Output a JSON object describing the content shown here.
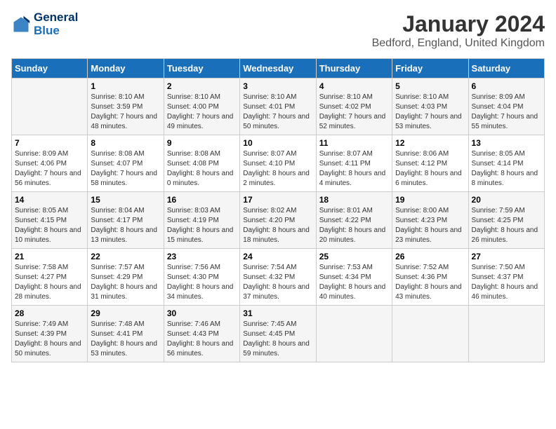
{
  "header": {
    "logo_line1": "General",
    "logo_line2": "Blue",
    "month_title": "January 2024",
    "location": "Bedford, England, United Kingdom"
  },
  "days_of_week": [
    "Sunday",
    "Monday",
    "Tuesday",
    "Wednesday",
    "Thursday",
    "Friday",
    "Saturday"
  ],
  "weeks": [
    [
      {
        "day": "",
        "sunrise": "",
        "sunset": "",
        "daylight": ""
      },
      {
        "day": "1",
        "sunrise": "Sunrise: 8:10 AM",
        "sunset": "Sunset: 3:59 PM",
        "daylight": "Daylight: 7 hours and 48 minutes."
      },
      {
        "day": "2",
        "sunrise": "Sunrise: 8:10 AM",
        "sunset": "Sunset: 4:00 PM",
        "daylight": "Daylight: 7 hours and 49 minutes."
      },
      {
        "day": "3",
        "sunrise": "Sunrise: 8:10 AM",
        "sunset": "Sunset: 4:01 PM",
        "daylight": "Daylight: 7 hours and 50 minutes."
      },
      {
        "day": "4",
        "sunrise": "Sunrise: 8:10 AM",
        "sunset": "Sunset: 4:02 PM",
        "daylight": "Daylight: 7 hours and 52 minutes."
      },
      {
        "day": "5",
        "sunrise": "Sunrise: 8:10 AM",
        "sunset": "Sunset: 4:03 PM",
        "daylight": "Daylight: 7 hours and 53 minutes."
      },
      {
        "day": "6",
        "sunrise": "Sunrise: 8:09 AM",
        "sunset": "Sunset: 4:04 PM",
        "daylight": "Daylight: 7 hours and 55 minutes."
      }
    ],
    [
      {
        "day": "7",
        "sunrise": "Sunrise: 8:09 AM",
        "sunset": "Sunset: 4:06 PM",
        "daylight": "Daylight: 7 hours and 56 minutes."
      },
      {
        "day": "8",
        "sunrise": "Sunrise: 8:08 AM",
        "sunset": "Sunset: 4:07 PM",
        "daylight": "Daylight: 7 hours and 58 minutes."
      },
      {
        "day": "9",
        "sunrise": "Sunrise: 8:08 AM",
        "sunset": "Sunset: 4:08 PM",
        "daylight": "Daylight: 8 hours and 0 minutes."
      },
      {
        "day": "10",
        "sunrise": "Sunrise: 8:07 AM",
        "sunset": "Sunset: 4:10 PM",
        "daylight": "Daylight: 8 hours and 2 minutes."
      },
      {
        "day": "11",
        "sunrise": "Sunrise: 8:07 AM",
        "sunset": "Sunset: 4:11 PM",
        "daylight": "Daylight: 8 hours and 4 minutes."
      },
      {
        "day": "12",
        "sunrise": "Sunrise: 8:06 AM",
        "sunset": "Sunset: 4:12 PM",
        "daylight": "Daylight: 8 hours and 6 minutes."
      },
      {
        "day": "13",
        "sunrise": "Sunrise: 8:05 AM",
        "sunset": "Sunset: 4:14 PM",
        "daylight": "Daylight: 8 hours and 8 minutes."
      }
    ],
    [
      {
        "day": "14",
        "sunrise": "Sunrise: 8:05 AM",
        "sunset": "Sunset: 4:15 PM",
        "daylight": "Daylight: 8 hours and 10 minutes."
      },
      {
        "day": "15",
        "sunrise": "Sunrise: 8:04 AM",
        "sunset": "Sunset: 4:17 PM",
        "daylight": "Daylight: 8 hours and 13 minutes."
      },
      {
        "day": "16",
        "sunrise": "Sunrise: 8:03 AM",
        "sunset": "Sunset: 4:19 PM",
        "daylight": "Daylight: 8 hours and 15 minutes."
      },
      {
        "day": "17",
        "sunrise": "Sunrise: 8:02 AM",
        "sunset": "Sunset: 4:20 PM",
        "daylight": "Daylight: 8 hours and 18 minutes."
      },
      {
        "day": "18",
        "sunrise": "Sunrise: 8:01 AM",
        "sunset": "Sunset: 4:22 PM",
        "daylight": "Daylight: 8 hours and 20 minutes."
      },
      {
        "day": "19",
        "sunrise": "Sunrise: 8:00 AM",
        "sunset": "Sunset: 4:23 PM",
        "daylight": "Daylight: 8 hours and 23 minutes."
      },
      {
        "day": "20",
        "sunrise": "Sunrise: 7:59 AM",
        "sunset": "Sunset: 4:25 PM",
        "daylight": "Daylight: 8 hours and 26 minutes."
      }
    ],
    [
      {
        "day": "21",
        "sunrise": "Sunrise: 7:58 AM",
        "sunset": "Sunset: 4:27 PM",
        "daylight": "Daylight: 8 hours and 28 minutes."
      },
      {
        "day": "22",
        "sunrise": "Sunrise: 7:57 AM",
        "sunset": "Sunset: 4:29 PM",
        "daylight": "Daylight: 8 hours and 31 minutes."
      },
      {
        "day": "23",
        "sunrise": "Sunrise: 7:56 AM",
        "sunset": "Sunset: 4:30 PM",
        "daylight": "Daylight: 8 hours and 34 minutes."
      },
      {
        "day": "24",
        "sunrise": "Sunrise: 7:54 AM",
        "sunset": "Sunset: 4:32 PM",
        "daylight": "Daylight: 8 hours and 37 minutes."
      },
      {
        "day": "25",
        "sunrise": "Sunrise: 7:53 AM",
        "sunset": "Sunset: 4:34 PM",
        "daylight": "Daylight: 8 hours and 40 minutes."
      },
      {
        "day": "26",
        "sunrise": "Sunrise: 7:52 AM",
        "sunset": "Sunset: 4:36 PM",
        "daylight": "Daylight: 8 hours and 43 minutes."
      },
      {
        "day": "27",
        "sunrise": "Sunrise: 7:50 AM",
        "sunset": "Sunset: 4:37 PM",
        "daylight": "Daylight: 8 hours and 46 minutes."
      }
    ],
    [
      {
        "day": "28",
        "sunrise": "Sunrise: 7:49 AM",
        "sunset": "Sunset: 4:39 PM",
        "daylight": "Daylight: 8 hours and 50 minutes."
      },
      {
        "day": "29",
        "sunrise": "Sunrise: 7:48 AM",
        "sunset": "Sunset: 4:41 PM",
        "daylight": "Daylight: 8 hours and 53 minutes."
      },
      {
        "day": "30",
        "sunrise": "Sunrise: 7:46 AM",
        "sunset": "Sunset: 4:43 PM",
        "daylight": "Daylight: 8 hours and 56 minutes."
      },
      {
        "day": "31",
        "sunrise": "Sunrise: 7:45 AM",
        "sunset": "Sunset: 4:45 PM",
        "daylight": "Daylight: 8 hours and 59 minutes."
      },
      {
        "day": "",
        "sunrise": "",
        "sunset": "",
        "daylight": ""
      },
      {
        "day": "",
        "sunrise": "",
        "sunset": "",
        "daylight": ""
      },
      {
        "day": "",
        "sunrise": "",
        "sunset": "",
        "daylight": ""
      }
    ]
  ]
}
